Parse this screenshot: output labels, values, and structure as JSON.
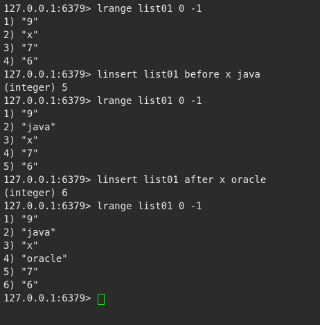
{
  "terminal": {
    "cursor_color": "#22dd22",
    "lines": [
      "127.0.0.1:6379> lrange list01 0 -1",
      "1) \"9\"",
      "2) \"x\"",
      "3) \"7\"",
      "4) \"6\"",
      "127.0.0.1:6379> linsert list01 before x java",
      "(integer) 5",
      "127.0.0.1:6379> lrange list01 0 -1",
      "1) \"9\"",
      "2) \"java\"",
      "3) \"x\"",
      "4) \"7\"",
      "5) \"6\"",
      "127.0.0.1:6379> linsert list01 after x oracle",
      "(integer) 6",
      "127.0.0.1:6379> lrange list01 0 -1",
      "1) \"9\"",
      "2) \"java\"",
      "3) \"x\"",
      "4) \"oracle\"",
      "5) \"7\"",
      "6) \"6\""
    ],
    "prompt": "127.0.0.1:6379> "
  }
}
